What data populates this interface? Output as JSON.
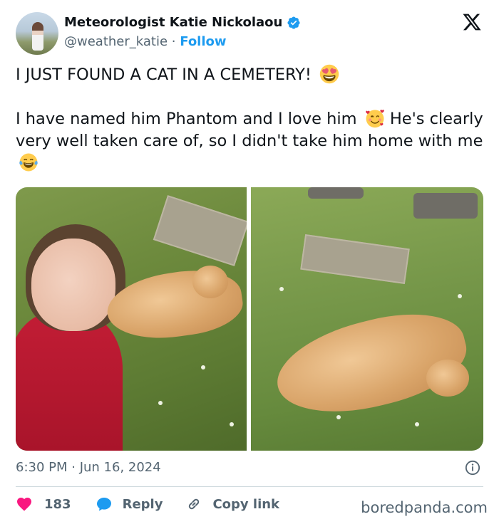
{
  "author": {
    "display_name": "Meteorologist Katie Nickolaou",
    "handle": "@weather_katie",
    "separator": "·",
    "follow_label": "Follow",
    "verified": true
  },
  "tweet": {
    "line1": "I JUST FOUND A CAT IN A CEMETERY!",
    "line2": "I have named him Phantom and I love him",
    "line3": "He's clearly very well taken care of, so I didn't take him home with me",
    "emojis": [
      "heart-eyes-emoji",
      "smiling-hearts-emoji",
      "tears-of-joy-emoji"
    ]
  },
  "media": {
    "photos": [
      "woman-selfie-with-cat-photo",
      "cat-lying-on-back-photo"
    ]
  },
  "meta": {
    "timestamp": "6:30 PM · Jun 16, 2024"
  },
  "actions": {
    "like_count": "183",
    "reply_label": "Reply",
    "copy_label": "Copy link"
  },
  "watermark": "boredpanda.com",
  "colors": {
    "accent": "#1d9bf0",
    "like": "#f91880",
    "text": "#0f1419",
    "muted": "#536471"
  }
}
